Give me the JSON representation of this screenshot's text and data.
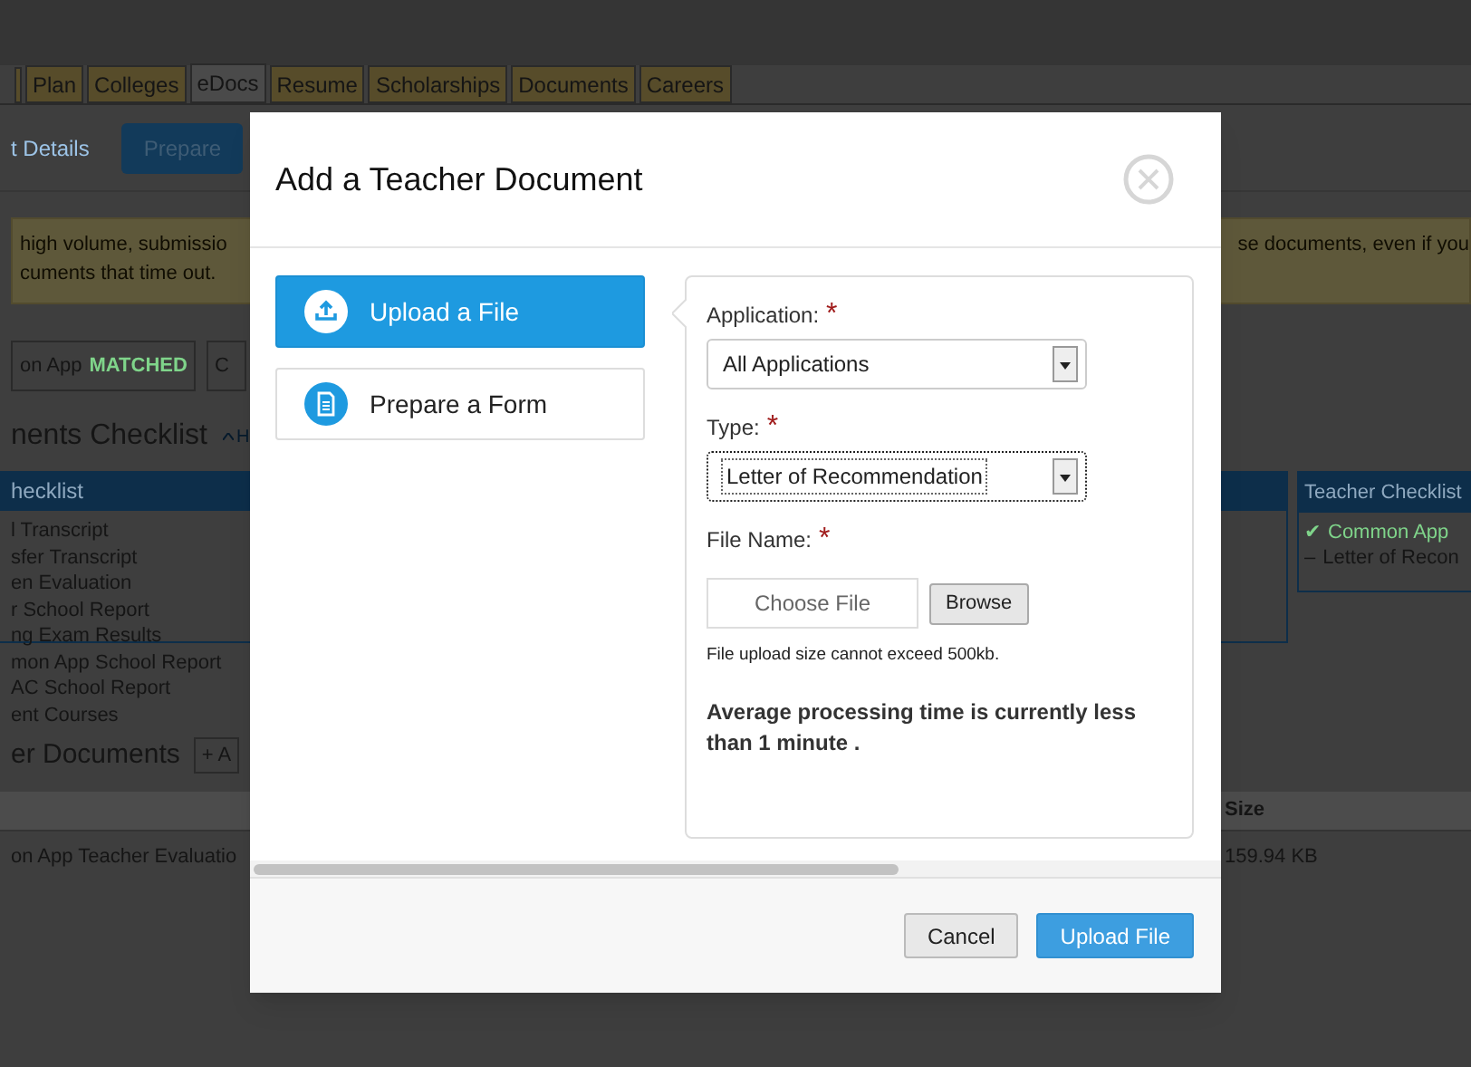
{
  "background": {
    "tabs": [
      {
        "label": "Plan",
        "selected": false
      },
      {
        "label": "Colleges",
        "selected": false
      },
      {
        "label": "eDocs",
        "selected": true
      },
      {
        "label": "Resume",
        "selected": false
      },
      {
        "label": "Scholarships",
        "selected": false
      },
      {
        "label": "Documents",
        "selected": false
      },
      {
        "label": "Careers",
        "selected": false
      }
    ],
    "details_link": "t Details",
    "prepare_button": "Prepare",
    "notice": {
      "left_lines": [
        "high volume, submissio",
        "cuments that time out."
      ],
      "right_line": "se documents, even if you"
    },
    "app_button": {
      "label": "on App",
      "status": "MATCHED"
    },
    "second_button": "C",
    "checklist_heading": "nents Checklist",
    "collapse_link": "H",
    "checklist_header": "hecklist",
    "checklist_items": [
      "l Transcript",
      "sfer Transcript",
      "en Evaluation",
      "r School Report",
      "ng Exam Results",
      "mon App School Report",
      "AC School Report",
      "ent Courses"
    ],
    "teacher_checklist": {
      "title": "Teacher Checklist",
      "items": [
        {
          "mark": "✔",
          "label": "Common App",
          "done": true
        },
        {
          "mark": "–",
          "label": "Letter of Recon",
          "done": false
        }
      ]
    },
    "other_docs": {
      "heading": "er Documents",
      "add_button": "+ A",
      "size_column": "Size",
      "rows": [
        {
          "name": "on App Teacher Evaluatio",
          "size": "159.94 KB"
        }
      ]
    }
  },
  "modal": {
    "title": "Add a Teacher Document",
    "options": [
      {
        "label": "Upload a File",
        "kind": "upload",
        "selected": true
      },
      {
        "label": "Prepare a Form",
        "kind": "form",
        "selected": false
      }
    ],
    "fields": [
      {
        "label": "Application:",
        "required_mark": "*",
        "kind": "select",
        "value": "All Applications",
        "focused": false
      },
      {
        "label": "Type:",
        "required_mark": "*",
        "kind": "select",
        "value": "Letter of Recommendation",
        "focused": true
      },
      {
        "label": "File Name:",
        "required_mark": "*",
        "kind": "file",
        "placeholder": "Choose File",
        "button": "Browse"
      }
    ],
    "note": "File upload size cannot exceed 500kb.",
    "processing": "Average processing time is currently less than 1 minute .",
    "buttons": [
      {
        "label": "Cancel",
        "kind": "secondary"
      },
      {
        "label": "Upload File",
        "kind": "primary"
      }
    ]
  }
}
